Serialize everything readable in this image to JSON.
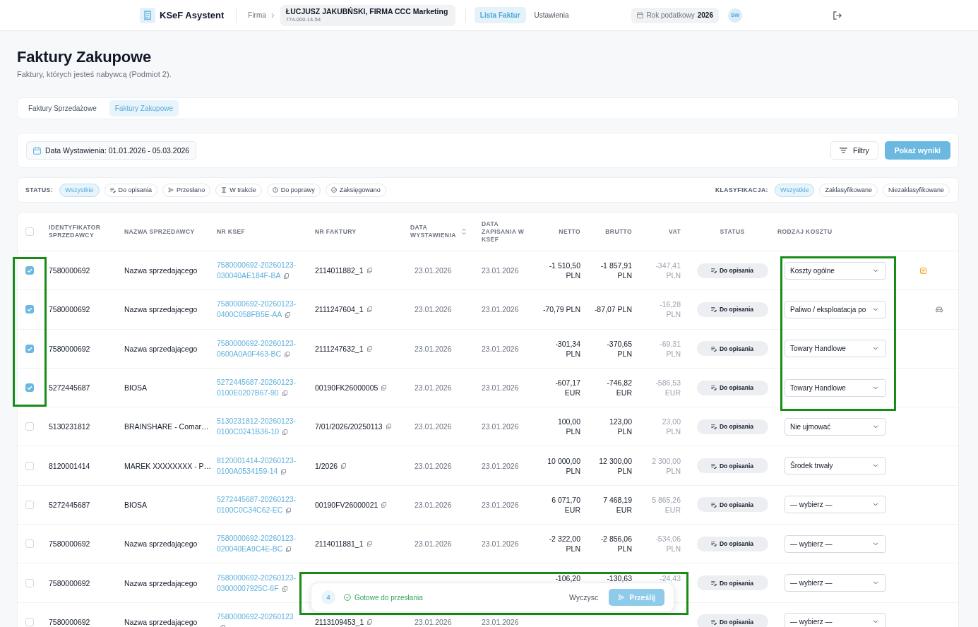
{
  "top_bar": {
    "app_name": "KSeF Asystent",
    "company_label": "Firma",
    "company": {
      "name": "ŁUCJUSZ JAKUBŃSKI, FIRMA CCC Marketing",
      "tax_id": "774-000-14-54"
    },
    "nav": [
      {
        "label": "Lista Faktur",
        "selected": true
      },
      {
        "label": "Ustawienia",
        "selected": false
      }
    ],
    "tax_year": {
      "label": "Rok podatkowy",
      "value": "2026"
    },
    "user_initials": "SW"
  },
  "page": {
    "title": "Faktury Zakupowe",
    "subtitle": "Faktury, których jesteś nabywcą (Podmiot 2)."
  },
  "invoice_tabs": [
    {
      "label": "Faktury Sprzedażowe",
      "selected": false
    },
    {
      "label": "Faktury Zakupowe",
      "selected": true
    }
  ],
  "filter_bar": {
    "date_range": "Data Wystawienia: 01.01.2026 - 05.03.2026",
    "filters_button": "Filtry",
    "apply_button": "Pokaż wyniki"
  },
  "status_filter": {
    "label": "STATUS:",
    "chips": [
      {
        "label": "Wszystkie",
        "kind": "all",
        "selected": true
      },
      {
        "label": "Do opisania",
        "kind": "to_describe",
        "selected": false
      },
      {
        "label": "Przesłano",
        "kind": "sent",
        "selected": false
      },
      {
        "label": "W trakcie",
        "kind": "in_progress",
        "selected": false
      },
      {
        "label": "Do poprawy",
        "kind": "to_fix",
        "selected": false
      },
      {
        "label": "Zaksięgowano",
        "kind": "booked",
        "selected": false
      }
    ]
  },
  "classification_filter": {
    "label": "KLASYFIKACJA:",
    "chips": [
      {
        "label": "Wszystkie",
        "selected": true
      },
      {
        "label": "Zaklasyfikowane",
        "selected": false
      },
      {
        "label": "Niezaklasyfikowane",
        "selected": false
      }
    ]
  },
  "table": {
    "select_all": false,
    "highlight_selection": true,
    "columns": [
      {
        "label": "IDENTYFIKATOR SPRZEDAWCY",
        "kind": "text",
        "sortable": false
      },
      {
        "label": "NAZWA SPRZEDAWCY",
        "kind": "text",
        "sortable": false
      },
      {
        "label": "NR KSEF",
        "kind": "text",
        "sortable": false
      },
      {
        "label": "NR FAKTURY",
        "kind": "text",
        "sortable": false
      },
      {
        "label": "DATA WYSTAWIENIA",
        "kind": "text",
        "sortable": true
      },
      {
        "label": "DATA ZAPISANIA W KSEF",
        "kind": "text",
        "sortable": false
      },
      {
        "label": "NETTO",
        "kind": "amount",
        "sortable": false
      },
      {
        "label": "BRUTTO",
        "kind": "amount",
        "sortable": false
      },
      {
        "label": "VAT",
        "kind": "amount",
        "sortable": false
      },
      {
        "label": "STATUS",
        "kind": "status",
        "sortable": false
      },
      {
        "label": "RODZAJ KOSZTU",
        "kind": "text",
        "sortable": false
      }
    ],
    "rows": [
      {
        "selected": true,
        "seller_id": "7580000692",
        "seller_name": "Nazwa sprzedającego",
        "ksef_number": "7580000692-20260123-030040AE184F-BA",
        "invoice_number": "2114011882_1",
        "issue_date": "23.01.2026",
        "saved_date": "23.01.2026",
        "net": {
          "value": "-1 510,50",
          "currency": "PLN"
        },
        "gross": {
          "value": "-1 857,91",
          "currency": "PLN"
        },
        "vat": {
          "value": "-347,41",
          "currency": "PLN"
        },
        "status": {
          "label": "Do opisania",
          "kind": "to_describe"
        },
        "cost_type": "Koszty ogólne",
        "note": true,
        "vehicle": false
      },
      {
        "selected": true,
        "seller_id": "7580000692",
        "seller_name": "Nazwa sprzedającego",
        "ksef_number": "7580000692-20260123-0400C058FB5E-AA",
        "invoice_number": "2111247604_1",
        "issue_date": "23.01.2026",
        "saved_date": "23.01.2026",
        "net": {
          "value": "-70,79",
          "currency": "PLN"
        },
        "gross": {
          "value": "-87,07",
          "currency": "PLN"
        },
        "vat": {
          "value": "-16,28",
          "currency": "PLN"
        },
        "status": {
          "label": "Do opisania",
          "kind": "to_describe"
        },
        "cost_type": "Paliwo / eksploatacja po",
        "note": false,
        "vehicle": true
      },
      {
        "selected": true,
        "seller_id": "7580000692",
        "seller_name": "Nazwa sprzedającego",
        "ksef_number": "7580000692-20260123-0600A0A0F463-BC",
        "invoice_number": "2111247632_1",
        "issue_date": "23.01.2026",
        "saved_date": "23.01.2026",
        "net": {
          "value": "-301,34",
          "currency": "PLN"
        },
        "gross": {
          "value": "-370,65",
          "currency": "PLN"
        },
        "vat": {
          "value": "-69,31",
          "currency": "PLN"
        },
        "status": {
          "label": "Do opisania",
          "kind": "to_describe"
        },
        "cost_type": "Towary Handlowe",
        "note": false,
        "vehicle": false
      },
      {
        "selected": true,
        "seller_id": "5272445687",
        "seller_name": "BIOSA",
        "ksef_number": "5272445687-20260123-0100E0207B67-90",
        "invoice_number": "00190FK26000005",
        "issue_date": "23.01.2026",
        "saved_date": "23.01.2026",
        "net": {
          "value": "-607,17",
          "currency": "EUR"
        },
        "gross": {
          "value": "-746,82",
          "currency": "EUR"
        },
        "vat": {
          "value": "-586,53",
          "currency": "EUR"
        },
        "status": {
          "label": "Do opisania",
          "kind": "to_describe"
        },
        "cost_type": "Towary Handlowe",
        "note": false,
        "vehicle": false
      },
      {
        "selected": false,
        "seller_id": "5130231812",
        "seller_name": "BRAINSHARE - Comar…",
        "ksef_number": "5130231812-20260123-0100C0241B36-10",
        "invoice_number": "7/01/2026/20250113",
        "issue_date": "23.01.2026",
        "saved_date": "23.01.2026",
        "net": {
          "value": "100,00",
          "currency": "PLN"
        },
        "gross": {
          "value": "123,00",
          "currency": "PLN"
        },
        "vat": {
          "value": "23,00",
          "currency": "PLN"
        },
        "status": {
          "label": "Do opisania",
          "kind": "to_describe"
        },
        "cost_type": "Nie ujmować",
        "note": false,
        "vehicle": false
      },
      {
        "selected": false,
        "seller_id": "8120001414",
        "seller_name": "MAREK XXXXXXXX - P…",
        "ksef_number": "8120001414-20260123-0100A0534159-14",
        "invoice_number": "1/2026",
        "issue_date": "23.01.2026",
        "saved_date": "23.01.2026",
        "net": {
          "value": "10 000,00",
          "currency": "PLN"
        },
        "gross": {
          "value": "12 300,00",
          "currency": "PLN"
        },
        "vat": {
          "value": "2 300,00",
          "currency": "PLN"
        },
        "status": {
          "label": "Do opisania",
          "kind": "to_describe"
        },
        "cost_type": "Środek trwały",
        "note": false,
        "vehicle": false
      },
      {
        "selected": false,
        "seller_id": "5272445687",
        "seller_name": "BIOSA",
        "ksef_number": "5272445687-20260123-0100C0C34C62-EC",
        "invoice_number": "00190FV26000021",
        "issue_date": "23.01.2026",
        "saved_date": "23.01.2026",
        "net": {
          "value": "6 071,70",
          "currency": "EUR"
        },
        "gross": {
          "value": "7 468,19",
          "currency": "EUR"
        },
        "vat": {
          "value": "5 865,26",
          "currency": "EUR"
        },
        "status": {
          "label": "Do opisania",
          "kind": "to_describe"
        },
        "cost_type": "— wybierz —",
        "note": false,
        "vehicle": false
      },
      {
        "selected": false,
        "seller_id": "7580000692",
        "seller_name": "Nazwa sprzedającego",
        "ksef_number": "7580000692-20260123-020040EA9C4E-BC",
        "invoice_number": "2114011881_1",
        "issue_date": "23.01.2026",
        "saved_date": "23.01.2026",
        "net": {
          "value": "-2 322,00",
          "currency": "PLN"
        },
        "gross": {
          "value": "-2 856,06",
          "currency": "PLN"
        },
        "vat": {
          "value": "-534,06",
          "currency": "PLN"
        },
        "status": {
          "label": "Do opisania",
          "kind": "to_describe"
        },
        "cost_type": "— wybierz —",
        "note": false,
        "vehicle": false
      },
      {
        "selected": false,
        "seller_id": "7580000692",
        "seller_name": "Nazwa sprzedającego",
        "ksef_number": "7580000692-20260123-03000007925C-6F",
        "net": {
          "value": "-106,20"
        },
        "gross": {
          "value": "-130,63"
        },
        "vat": {
          "value": "-24,43"
        },
        "status": {
          "label": "Do opisania",
          "kind": "to_describe"
        },
        "cost_type": "— wybierz —",
        "note": false,
        "vehicle": false
      },
      {
        "selected": false,
        "seller_id": "7580000692",
        "seller_name": "Nazwa sprzedającego",
        "ksef_number": "7580000692-20260123",
        "invoice_number": "2113109453_1",
        "issue_date": "23.01.2026",
        "saved_date": "23.01.2026",
        "status": {
          "label": "Do opisania",
          "kind": "to_describe"
        },
        "cost_type": "— wybierz —",
        "note": false,
        "vehicle": false
      }
    ]
  },
  "action_bar": {
    "highlighted": true,
    "count": "4",
    "status": "Gotowe do przesłania",
    "clear_button": "Wyczysc",
    "submit_button": "Prześlij"
  }
}
